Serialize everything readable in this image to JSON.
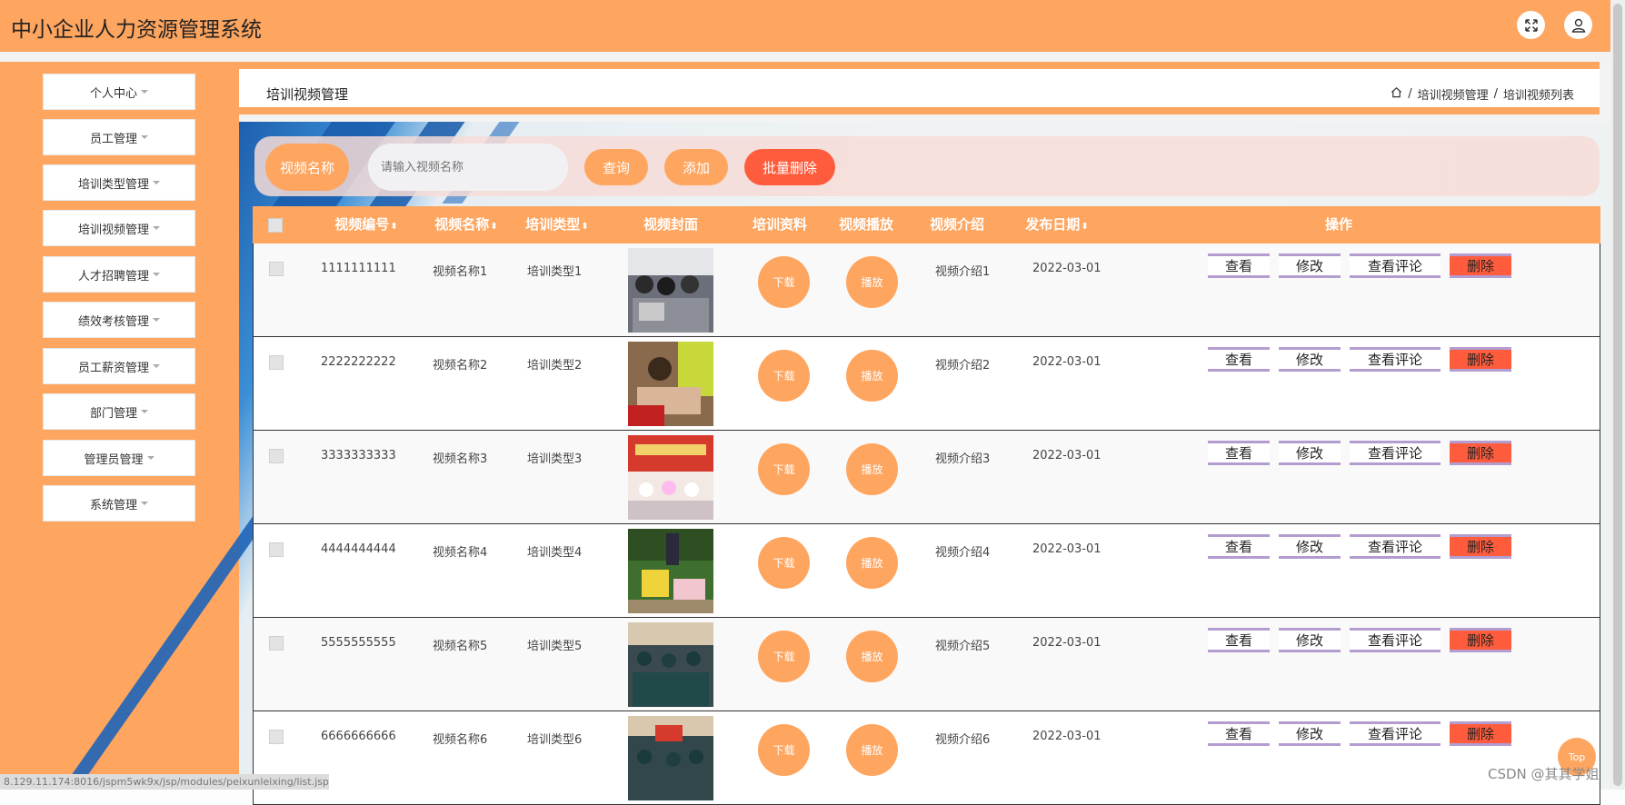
{
  "header": {
    "title": "中小企业人力资源管理系统"
  },
  "sidebar": {
    "items": [
      {
        "label": "个人中心"
      },
      {
        "label": "员工管理"
      },
      {
        "label": "培训类型管理"
      },
      {
        "label": "培训视频管理"
      },
      {
        "label": "人才招聘管理"
      },
      {
        "label": "绩效考核管理"
      },
      {
        "label": "员工薪资管理"
      },
      {
        "label": "部门管理"
      },
      {
        "label": "管理员管理"
      },
      {
        "label": "系统管理"
      }
    ]
  },
  "page": {
    "title": "培训视频管理",
    "breadcrumb": [
      "培训视频管理",
      "培训视频列表"
    ],
    "separator": "/"
  },
  "search": {
    "label": "视频名称",
    "placeholder": "请输入视频名称",
    "query_btn": "查询",
    "add_btn": "添加",
    "batch_delete_btn": "批量删除"
  },
  "table": {
    "columns": [
      "视频编号",
      "视频名称",
      "培训类型",
      "视频封面",
      "培训资料",
      "视频播放",
      "视频介绍",
      "发布日期",
      "操作"
    ],
    "sortable_marker": "⬍",
    "download_label": "下载",
    "play_label": "播放",
    "actions": {
      "view": "查看",
      "edit": "修改",
      "comments": "查看评论",
      "delete": "删除"
    },
    "rows": [
      {
        "id": "1111111111",
        "name": "视频名称1",
        "type": "培训类型1",
        "intro": "视频介绍1",
        "date": "2022-03-01"
      },
      {
        "id": "2222222222",
        "name": "视频名称2",
        "type": "培训类型2",
        "intro": "视频介绍2",
        "date": "2022-03-01"
      },
      {
        "id": "3333333333",
        "name": "视频名称3",
        "type": "培训类型3",
        "intro": "视频介绍3",
        "date": "2022-03-01"
      },
      {
        "id": "4444444444",
        "name": "视频名称4",
        "type": "培训类型4",
        "intro": "视频介绍4",
        "date": "2022-03-01"
      },
      {
        "id": "5555555555",
        "name": "视频名称5",
        "type": "培训类型5",
        "intro": "视频介绍5",
        "date": "2022-03-01"
      },
      {
        "id": "6666666666",
        "name": "视频名称6",
        "type": "培训类型6",
        "intro": "视频介绍6",
        "date": "2022-03-01"
      }
    ]
  },
  "status_url": "8.129.11.174:8016/jspm5wk9x/jsp/modules/peixunleixing/list.jsp#",
  "back_to_top": "Top",
  "watermark": "CSDN @其其学姐",
  "colors": {
    "accent": "#fea55f",
    "danger": "#ff5c3d",
    "action_border": "#b39ccf"
  }
}
